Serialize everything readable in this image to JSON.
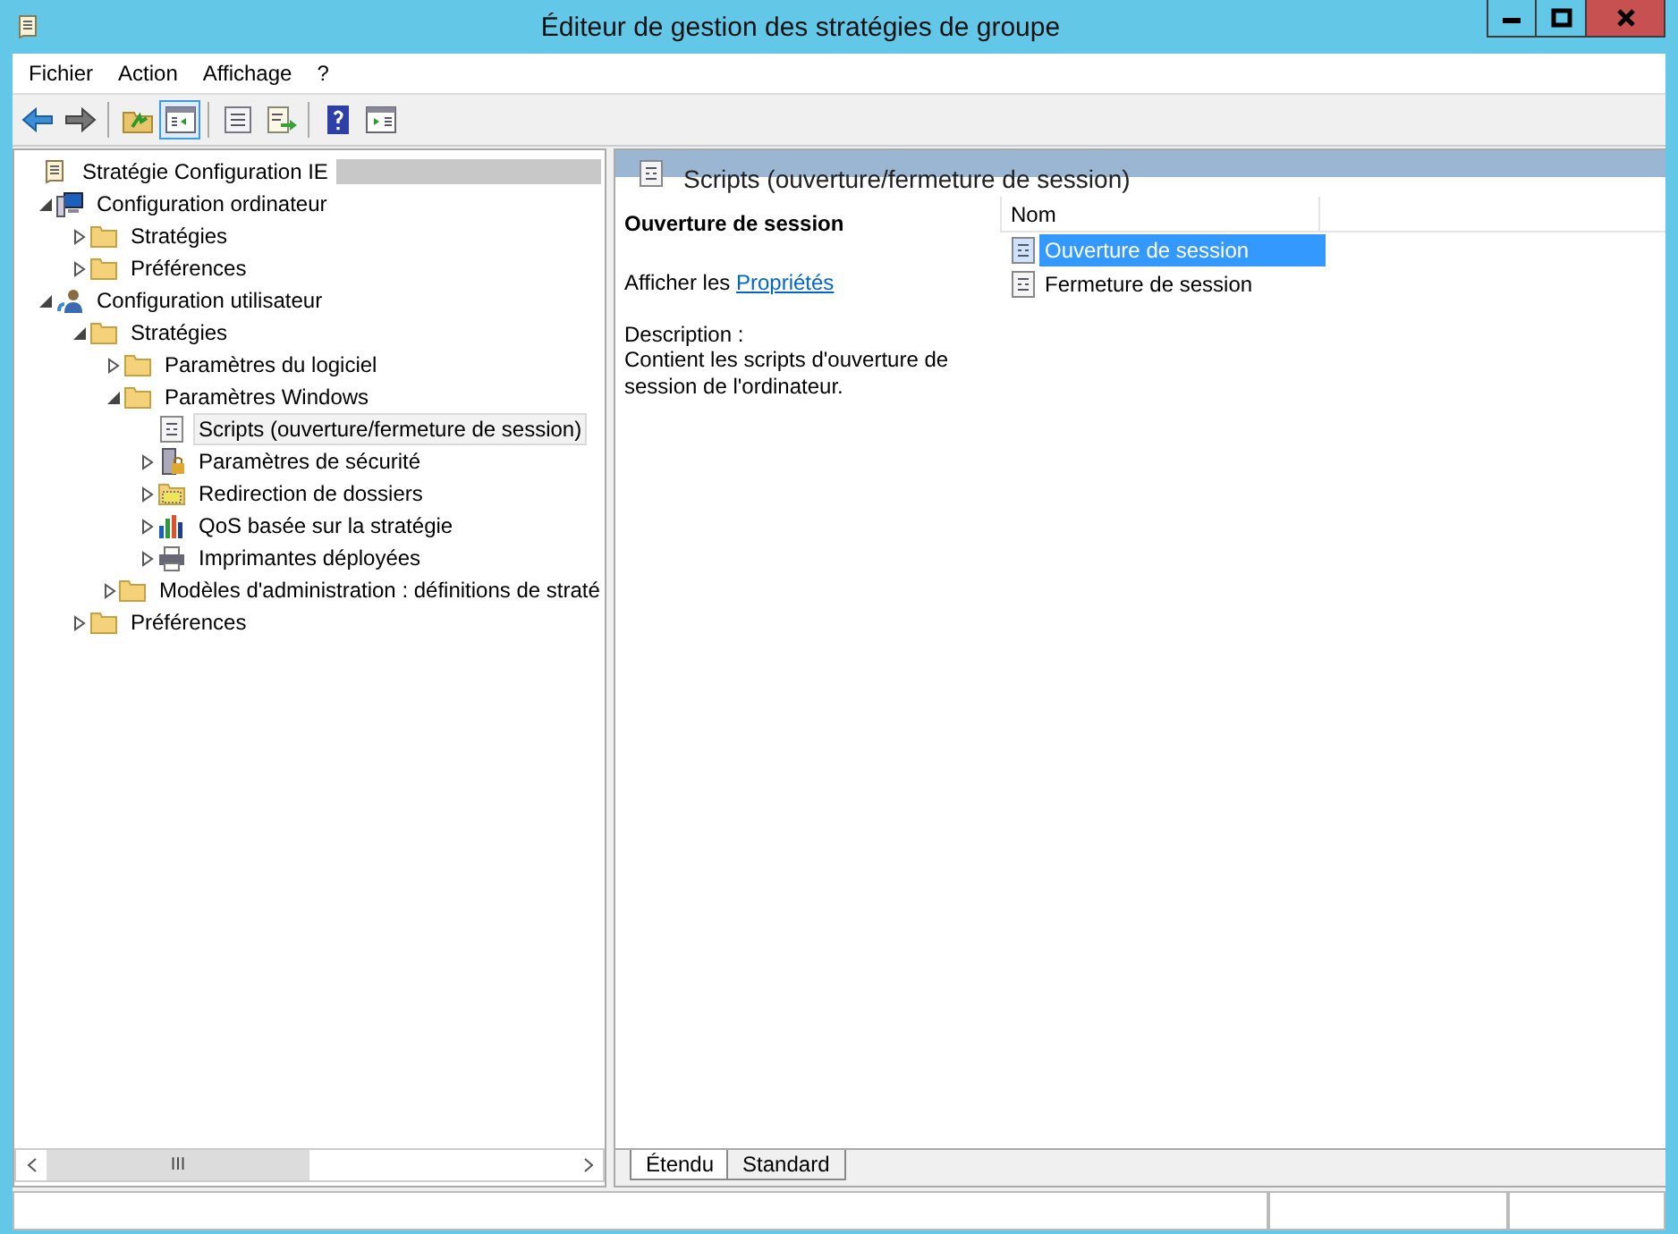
{
  "window": {
    "title": "Éditeur de gestion des stratégies de groupe"
  },
  "menu": [
    "Fichier",
    "Action",
    "Affichage",
    "?"
  ],
  "toolbar": [
    {
      "kind": "back",
      "pressed": false
    },
    {
      "kind": "forward",
      "pressed": false
    },
    {
      "kind": "up",
      "pressed": false
    },
    {
      "kind": "tree",
      "pressed": true
    },
    {
      "kind": "properties",
      "pressed": false
    },
    {
      "kind": "export",
      "pressed": false
    },
    {
      "kind": "help",
      "pressed": false
    },
    {
      "kind": "actionpane",
      "pressed": false
    }
  ],
  "tree": {
    "label": "Stratégie Configuration IE",
    "kind": "scroll",
    "selected": false,
    "children": [
      {
        "label": "Configuration ordinateur",
        "kind": "computer",
        "expanded": true,
        "selected": false,
        "children": [
          {
            "label": "Stratégies",
            "kind": "folder",
            "expanded": false,
            "selected": false
          },
          {
            "label": "Préférences",
            "kind": "folder",
            "expanded": false,
            "selected": false
          }
        ]
      },
      {
        "label": "Configuration utilisateur",
        "kind": "user",
        "expanded": true,
        "selected": false,
        "children": [
          {
            "label": "Stratégies",
            "kind": "folder",
            "expanded": true,
            "selected": false,
            "children": [
              {
                "label": "Paramètres du logiciel",
                "kind": "folder",
                "expanded": false,
                "selected": false
              },
              {
                "label": "Paramètres Windows",
                "kind": "folder",
                "expanded": true,
                "selected": false,
                "children": [
                  {
                    "label": "Scripts (ouverture/fermeture de session)",
                    "kind": "script",
                    "selected": true
                  },
                  {
                    "label": "Paramètres de sécurité",
                    "kind": "security",
                    "expanded": false,
                    "selected": false
                  },
                  {
                    "label": "Redirection de dossiers",
                    "kind": "redirect",
                    "expanded": false,
                    "selected": false
                  },
                  {
                    "label": "QoS basée sur la stratégie",
                    "kind": "qos",
                    "expanded": false,
                    "selected": false
                  },
                  {
                    "label": "Imprimantes déployées",
                    "kind": "printer",
                    "expanded": false,
                    "selected": false
                  }
                ]
              },
              {
                "label": "Modèles d'administration : définitions de straté",
                "kind": "folder",
                "expanded": false,
                "selected": false
              }
            ]
          },
          {
            "label": "Préférences",
            "kind": "folder",
            "expanded": false,
            "selected": false
          }
        ]
      }
    ]
  },
  "details": {
    "title": "Scripts (ouverture/fermeture de session)",
    "heading": "Ouverture de session",
    "show_prefix": "Afficher les",
    "show_link": "Propriétés",
    "description_label": "Description :",
    "description": "Contient les scripts d'ouverture de session de l'ordinateur."
  },
  "list": {
    "columns": [
      "Nom"
    ],
    "rows": [
      {
        "name": "Ouverture de session",
        "selected": true
      },
      {
        "name": "Fermeture de session",
        "selected": false
      }
    ]
  },
  "tabs": [
    {
      "label": "Étendu",
      "selected": true
    },
    {
      "label": "Standard",
      "selected": false
    }
  ],
  "scrollbar": {
    "thumb_glyph": "III"
  }
}
